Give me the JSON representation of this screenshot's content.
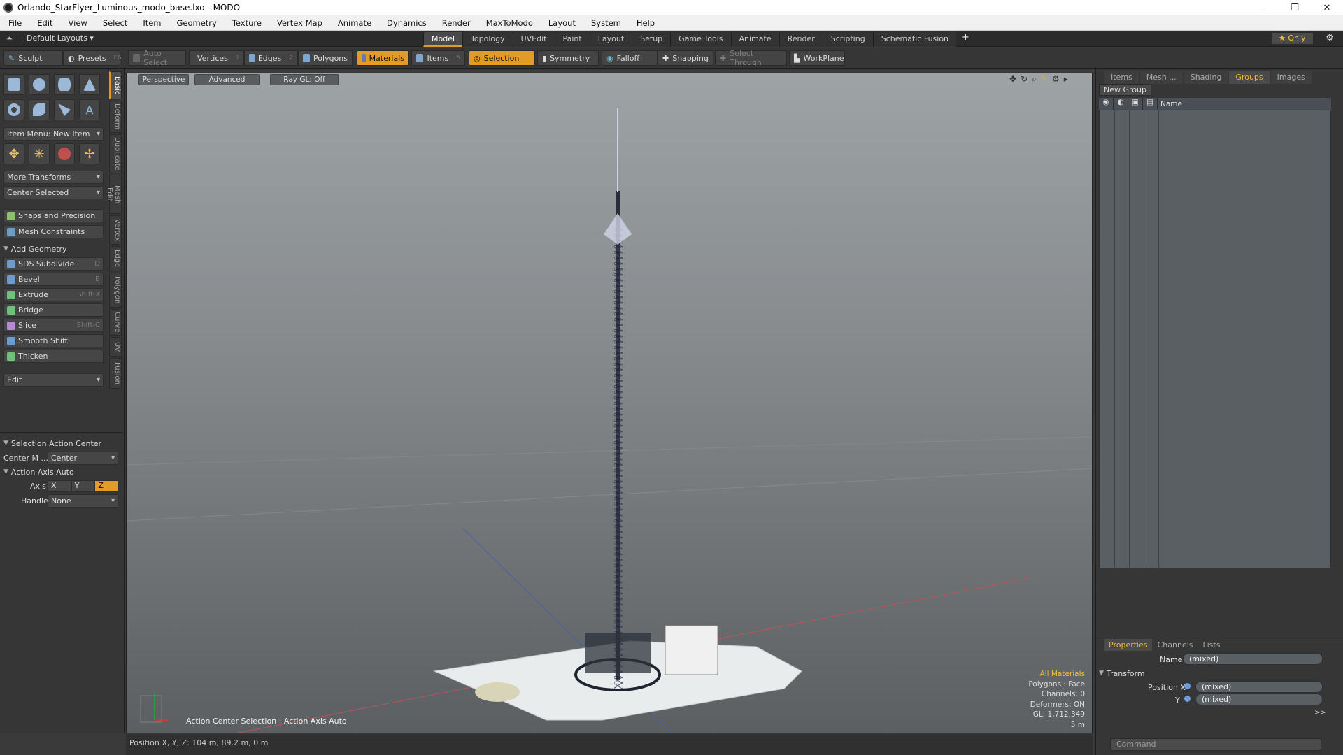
{
  "window": {
    "title": "Orlando_StarFlyer_Luminous_modo_base.lxo - MODO",
    "controls": [
      "–",
      "❐",
      "✕"
    ]
  },
  "menubar": [
    "File",
    "Edit",
    "View",
    "Select",
    "Item",
    "Geometry",
    "Texture",
    "Vertex Map",
    "Animate",
    "Dynamics",
    "Render",
    "MaxToModo",
    "Layout",
    "System",
    "Help"
  ],
  "layoutbar": {
    "layout_menu": "Default Layouts ▾",
    "tabs": [
      "Model",
      "Topology",
      "UVEdit",
      "Paint",
      "Layout",
      "Setup",
      "Game Tools",
      "Animate",
      "Render",
      "Scripting",
      "Schematic Fusion"
    ],
    "active_tab": "Model",
    "add": "+",
    "only": "★ Only",
    "gear": "⚙"
  },
  "toolbar": {
    "sculpt": "Sculpt",
    "presets": "Presets",
    "presets_key": "F6",
    "auto_select": "Auto Select",
    "vertices": "Vertices",
    "vertices_key": "1",
    "edges": "Edges",
    "edges_key": "2",
    "polygons": "Polygons",
    "materials": "Materials",
    "items": "Items",
    "items_key": "5",
    "selection": "Selection",
    "symmetry": "Symmetry",
    "falloff": "Falloff",
    "snapping": "Snapping",
    "select_through": "Select Through",
    "workplane": "WorkPlane"
  },
  "left": {
    "item_menu": "Item Menu: New Item",
    "more_transforms": "More Transforms",
    "center_selected": "Center Selected",
    "snaps": "Snaps and Precision",
    "mesh_constraints": "Mesh Constraints",
    "add_geometry": "Add Geometry",
    "tools": [
      {
        "label": "SDS Subdivide",
        "key": "D"
      },
      {
        "label": "Bevel",
        "key": "B"
      },
      {
        "label": "Extrude",
        "key": "Shift-X"
      },
      {
        "label": "Bridge",
        "key": ""
      },
      {
        "label": "Slice",
        "key": "Shift-C"
      },
      {
        "label": "Smooth Shift",
        "key": ""
      },
      {
        "label": "Thicken",
        "key": ""
      }
    ],
    "edit": "Edit",
    "sel_action_center": "Selection Action Center",
    "center_m_label": "Center M ...",
    "center_m_value": "Center",
    "action_axis": "Action Axis Auto",
    "axis_label": "Axis",
    "axis_x": "X",
    "axis_y": "Y",
    "axis_z": "Z",
    "handle_label": "Handle",
    "handle_value": "None",
    "vtabs": [
      "Basic",
      "Deform",
      "Duplicate",
      "Mesh Edit",
      "Vertex",
      "Edge",
      "Polygon",
      "Curve",
      "UV",
      "Fusion"
    ]
  },
  "viewport": {
    "perspective": "Perspective",
    "advanced": "Advanced",
    "raygl": "Ray GL: Off",
    "info": {
      "all_materials": "All Materials",
      "polygons": "Polygons : Face",
      "channels": "Channels: 0",
      "deformers": "Deformers: ON",
      "gl": "GL: 1,712,349",
      "scale": "5 m"
    },
    "action_center": "Action Center Selection : Action Axis Auto"
  },
  "status": "Position X, Y, Z:  104 m, 89.2 m, 0 m",
  "right": {
    "tabs": [
      "Items",
      "Mesh ...",
      "Shading",
      "Groups",
      "Images"
    ],
    "active_tab": "Groups",
    "new_group": "New Group",
    "col_name": "Name",
    "prop_tabs": [
      "Properties",
      "Channels",
      "Lists"
    ],
    "name_label": "Name",
    "name_value": "(mixed)",
    "transform": "Transform",
    "pos_x_label": "Position X",
    "pos_x_value": "(mixed)",
    "pos_y_label": "Y",
    "pos_y_value": "(mixed)",
    "more": ">>",
    "command_placeholder": "Command"
  }
}
